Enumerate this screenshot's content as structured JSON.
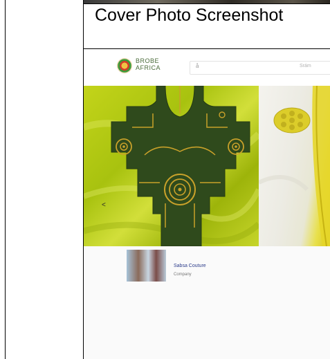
{
  "document": {
    "heading": "Cover Photo Screenshot"
  },
  "screenshot": {
    "logo_text_line1": "BROBE",
    "logo_text_line2": "AFRICA",
    "search_placeholder": "å",
    "search_right_text": "Srám",
    "carousel_arrow": "<",
    "profile_name": "Sabsa Couture",
    "profile_subtitle": "Company",
    "colors": {
      "fabric_green": "#b5cc1a",
      "embroidery_dark": "#2f4a1c",
      "embroidery_gold": "#c9a12a",
      "fabric_white": "#f2f1ea",
      "fabric_yellow": "#e3d42a"
    }
  }
}
